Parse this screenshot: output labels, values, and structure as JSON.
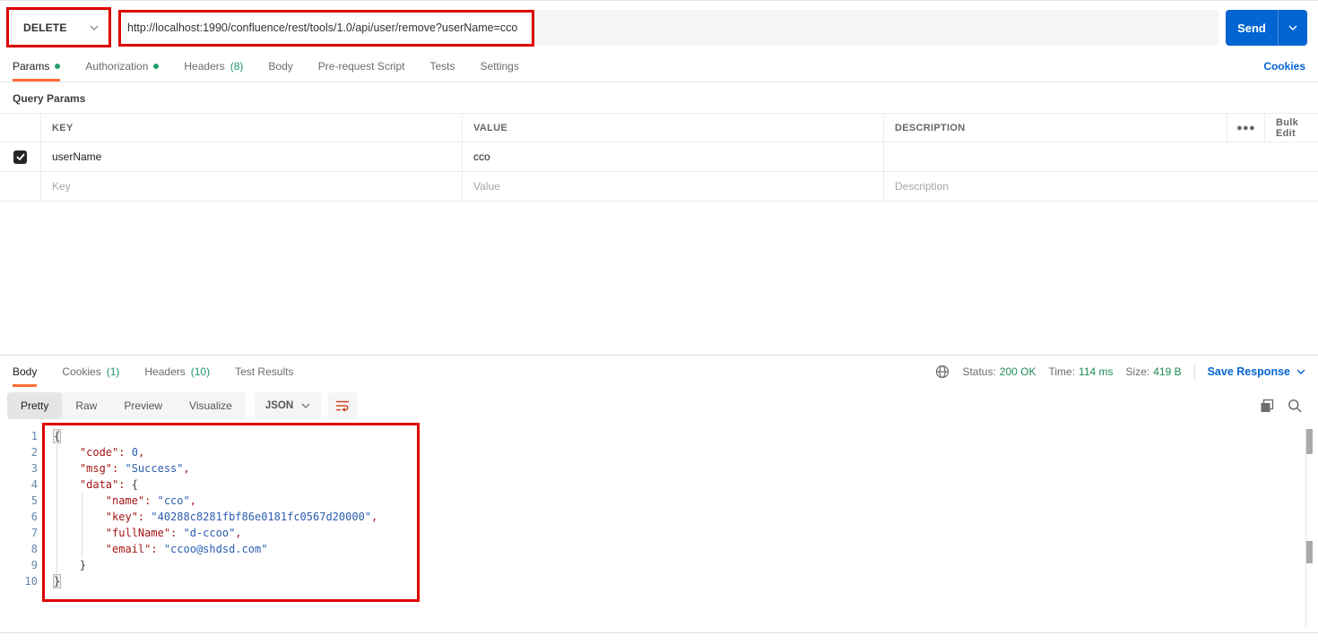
{
  "colors": {
    "accent_orange": "#ff6c37",
    "primary_blue": "#0265d2",
    "success_green": "#1d9467",
    "annotation_red": "#dd0000",
    "json_key_red": "#a31515",
    "json_value_blue": "#2a5db0"
  },
  "request": {
    "method": "DELETE",
    "url": "http://localhost:1990/confluence/rest/tools/1.0/api/user/remove?userName=cco",
    "send_label": "Send",
    "tabs": [
      {
        "label": "Params",
        "has_dot": true,
        "active": true
      },
      {
        "label": "Authorization",
        "has_dot": true
      },
      {
        "label": "Headers",
        "count": "(8)"
      },
      {
        "label": "Body"
      },
      {
        "label": "Pre-request Script"
      },
      {
        "label": "Tests"
      },
      {
        "label": "Settings"
      }
    ],
    "cookies_link": "Cookies",
    "query_params": {
      "title": "Query Params",
      "col_key": "KEY",
      "col_value": "VALUE",
      "col_description": "DESCRIPTION",
      "bulk_edit_label": "Bulk Edit",
      "rows": [
        {
          "checked": true,
          "key": "userName",
          "value": "cco",
          "description": ""
        }
      ],
      "new_row_placeholders": {
        "key": "Key",
        "value": "Value",
        "description": "Description"
      }
    }
  },
  "response": {
    "tabs": [
      {
        "label": "Body",
        "active": true
      },
      {
        "label": "Cookies",
        "count": "(1)"
      },
      {
        "label": "Headers",
        "count": "(10)"
      },
      {
        "label": "Test Results"
      }
    ],
    "meta": {
      "status_label": "Status:",
      "status_value": "200 OK",
      "time_label": "Time:",
      "time_value": "114 ms",
      "size_label": "Size:",
      "size_value": "419 B",
      "save_response_label": "Save Response"
    },
    "view_tabs": [
      {
        "label": "Pretty",
        "active": true
      },
      {
        "label": "Raw"
      },
      {
        "label": "Preview"
      },
      {
        "label": "Visualize"
      }
    ],
    "format_selector": "JSON",
    "body_json": {
      "code": 0,
      "msg": "Success",
      "data": {
        "name": "cco",
        "key": "40288c8281fbf86e0181fc0567d20000",
        "fullName": "d-ccoo",
        "email": "ccoo@shdsd.com"
      }
    },
    "code_lines": [
      {
        "num": 1,
        "tokens": [
          [
            "brm",
            "{"
          ]
        ]
      },
      {
        "num": 2,
        "tokens": [
          [
            "sp",
            "    "
          ],
          [
            "key",
            "\"code\""
          ],
          [
            "pun",
            ": "
          ],
          [
            "num",
            "0"
          ],
          [
            "pun",
            ","
          ]
        ]
      },
      {
        "num": 3,
        "tokens": [
          [
            "sp",
            "    "
          ],
          [
            "key",
            "\"msg\""
          ],
          [
            "pun",
            ": "
          ],
          [
            "str",
            "\"Success\""
          ],
          [
            "pun",
            ","
          ]
        ]
      },
      {
        "num": 4,
        "tokens": [
          [
            "sp",
            "    "
          ],
          [
            "key",
            "\"data\""
          ],
          [
            "pun",
            ": "
          ],
          [
            "br",
            "{"
          ]
        ]
      },
      {
        "num": 5,
        "tokens": [
          [
            "sp",
            "        "
          ],
          [
            "key",
            "\"name\""
          ],
          [
            "pun",
            ": "
          ],
          [
            "str",
            "\"cco\""
          ],
          [
            "pun",
            ","
          ]
        ]
      },
      {
        "num": 6,
        "tokens": [
          [
            "sp",
            "        "
          ],
          [
            "key",
            "\"key\""
          ],
          [
            "pun",
            ": "
          ],
          [
            "str",
            "\"40288c8281fbf86e0181fc0567d20000\""
          ],
          [
            "pun",
            ","
          ]
        ]
      },
      {
        "num": 7,
        "tokens": [
          [
            "sp",
            "        "
          ],
          [
            "key",
            "\"fullName\""
          ],
          [
            "pun",
            ": "
          ],
          [
            "str",
            "\"d-ccoo\""
          ],
          [
            "pun",
            ","
          ]
        ]
      },
      {
        "num": 8,
        "tokens": [
          [
            "sp",
            "        "
          ],
          [
            "key",
            "\"email\""
          ],
          [
            "pun",
            ": "
          ],
          [
            "str",
            "\"ccoo@shdsd.com\""
          ]
        ]
      },
      {
        "num": 9,
        "tokens": [
          [
            "sp",
            "    "
          ],
          [
            "br",
            "}"
          ]
        ]
      },
      {
        "num": 10,
        "tokens": [
          [
            "brm",
            "}"
          ]
        ]
      }
    ]
  }
}
